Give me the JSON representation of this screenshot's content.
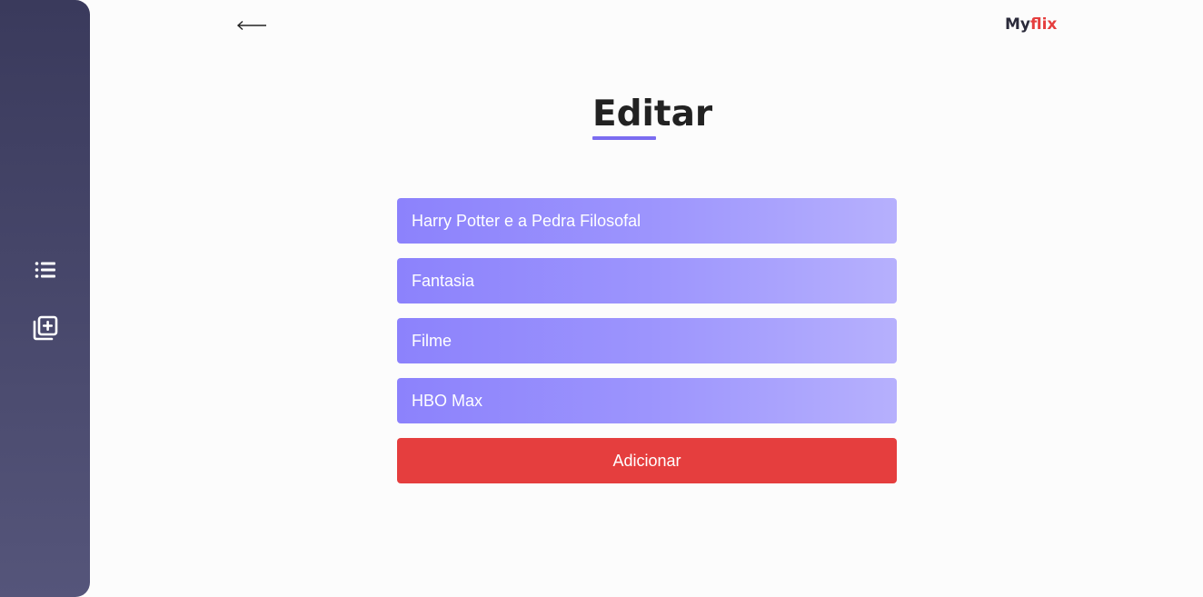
{
  "brand": {
    "part1": "My",
    "part2": "flix",
    "color_part1": "#2a2a3a",
    "color_part2": "#e53e3e"
  },
  "nav": {
    "back_icon": "arrow-left-icon"
  },
  "sidebar": {
    "items": [
      {
        "icon": "list-icon",
        "name": "list"
      },
      {
        "icon": "add-library-icon",
        "name": "add"
      }
    ]
  },
  "page": {
    "title": "Editar",
    "accent": "#7b6cf0"
  },
  "form": {
    "title_value": "Harry Potter e a Pedra Filosofal",
    "genre_value": "Fantasia",
    "type_value": "Filme",
    "platform_value": "HBO Max",
    "submit_label": "Adicionar",
    "submit_color": "#e53e3e"
  }
}
